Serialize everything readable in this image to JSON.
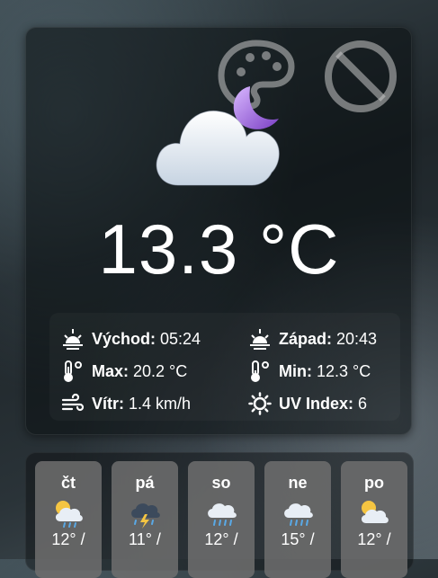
{
  "current": {
    "temperature": "13.3 °C",
    "icon": "cloud-moon-icon"
  },
  "toolbar": {
    "palette_icon": "palette-icon",
    "block_icon": "block-icon"
  },
  "details": {
    "sunrise_label": "Východ:",
    "sunrise_value": "05:24",
    "sunset_label": "Západ:",
    "sunset_value": "20:43",
    "max_label": "Max:",
    "max_value": "20.2 °C",
    "min_label": "Min:",
    "min_value": "12.3 °C",
    "wind_label": "Vítr:",
    "wind_value": "1.4 km/h",
    "uv_label": "UV Index:",
    "uv_value": "6"
  },
  "forecast": [
    {
      "day": "čt",
      "icon": "sun-cloud-rain-icon",
      "temp": "12° /"
    },
    {
      "day": "pá",
      "icon": "thunderstorm-icon",
      "temp": "11° /"
    },
    {
      "day": "so",
      "icon": "cloud-rain-icon",
      "temp": "12° /"
    },
    {
      "day": "ne",
      "icon": "cloud-rain-icon",
      "temp": "15° /"
    },
    {
      "day": "po",
      "icon": "sun-cloud-icon",
      "temp": "12° /"
    }
  ],
  "colors": {
    "accent_purple": "#a46bd6",
    "card_bg": "#0e1214",
    "day_card_bg": "#6e6e6e"
  }
}
